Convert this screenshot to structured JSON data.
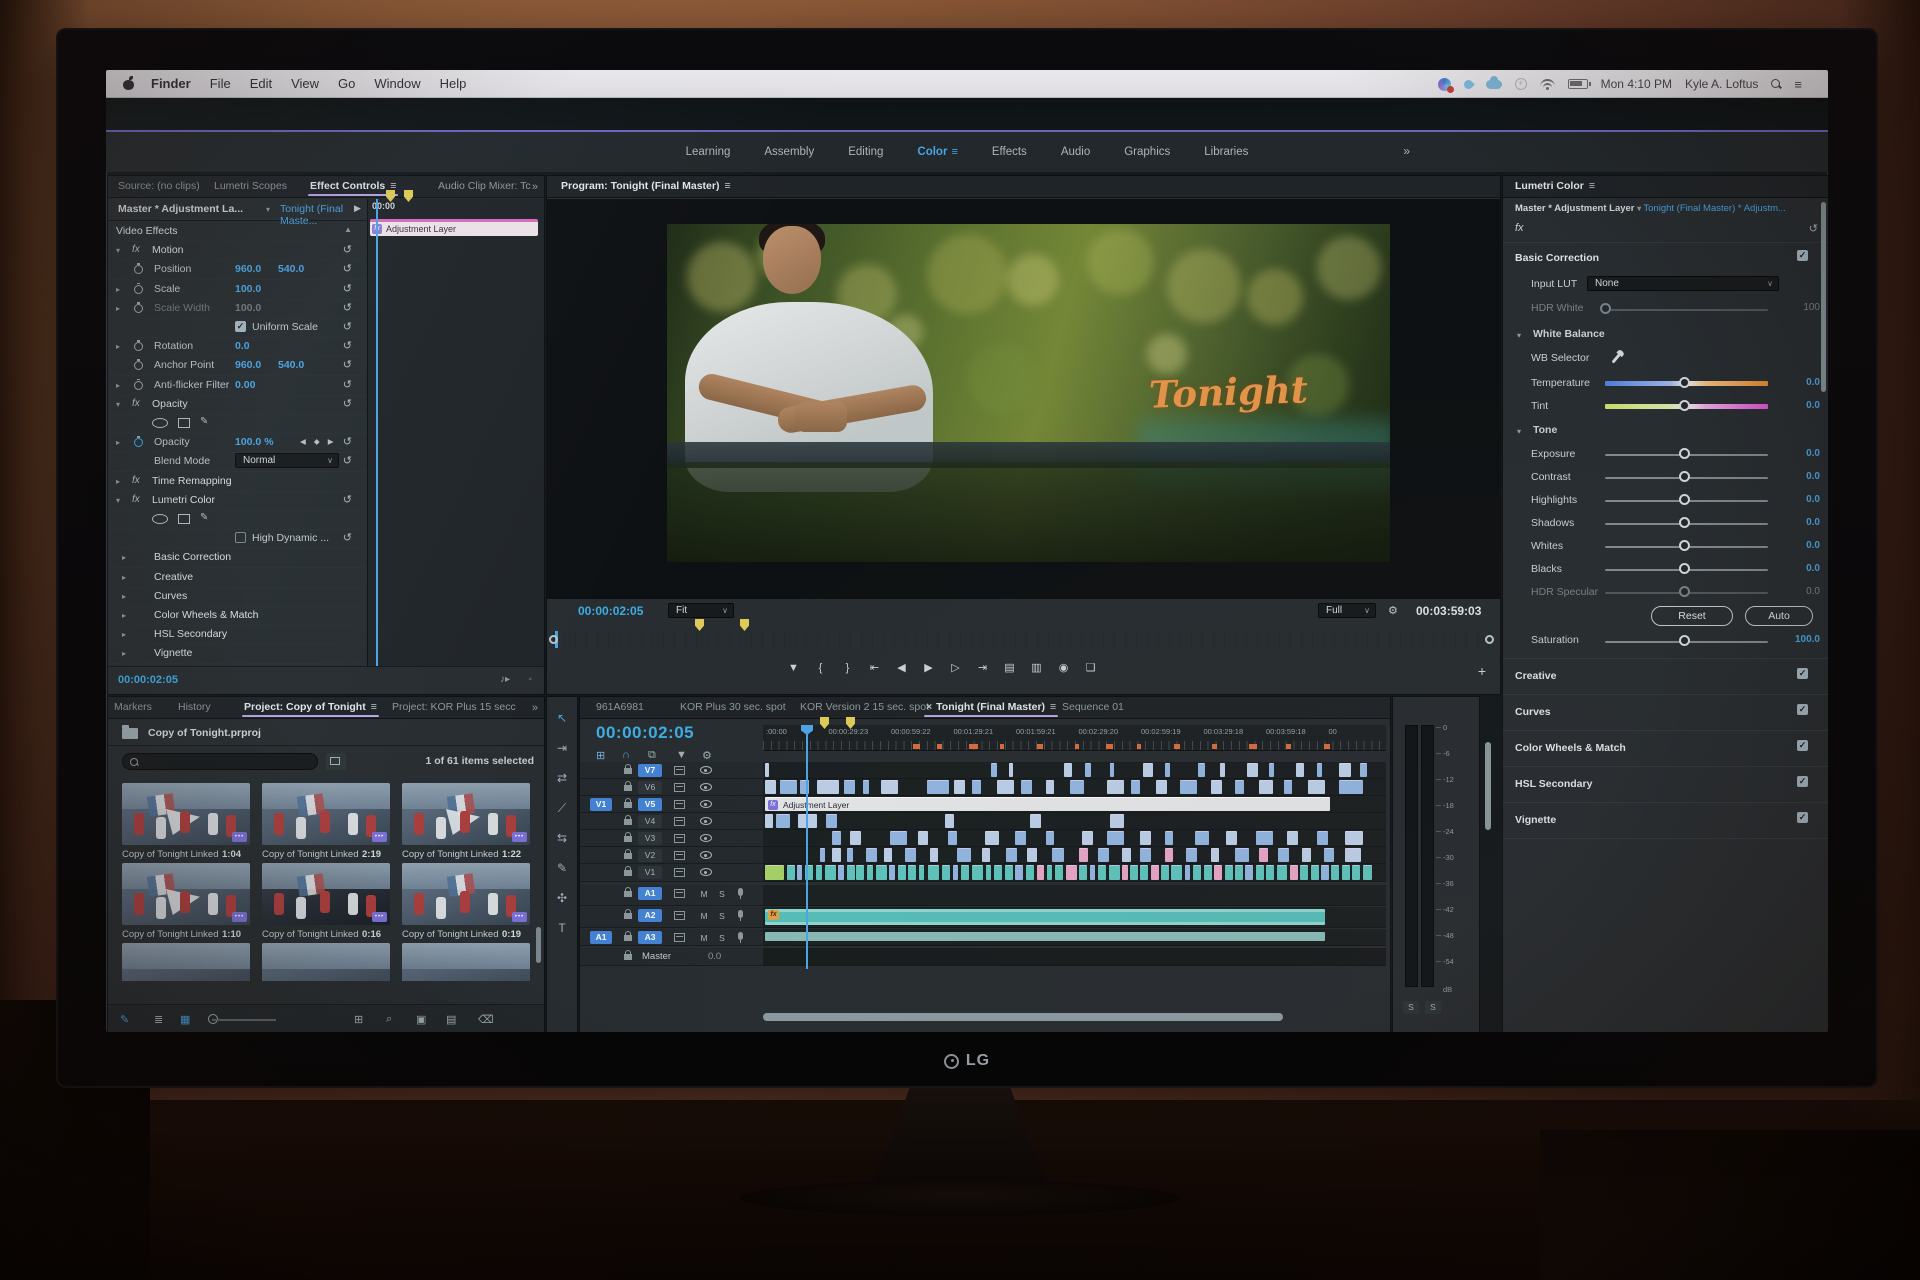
{
  "menubar": {
    "menus": [
      "Finder",
      "File",
      "Edit",
      "View",
      "Go",
      "Window",
      "Help"
    ],
    "status": {
      "time": "Mon 4:10 PM",
      "user": "Kyle A. Loftus"
    }
  },
  "workspace": {
    "tabs": [
      "Learning",
      "Assembly",
      "Editing",
      "Color",
      "Effects",
      "Audio",
      "Graphics",
      "Libraries"
    ],
    "active_index": 3,
    "menu_icon": "≡",
    "overflow": "»"
  },
  "effect_controls": {
    "tabs": [
      "Source: (no clips)",
      "Lumetri Scopes",
      "Effect Controls",
      "Audio Clip Mixer: Tc"
    ],
    "active_index": 2,
    "menu_icon": "≡",
    "overflow": "»",
    "master_label": "Master * Adjustment La...",
    "clip_label": "Tonight (Final Maste...",
    "mini_ruler_label": "00:00",
    "mini_clip_label": "Adjustment Layer",
    "timecode": "00:00:02:05",
    "rows": [
      {
        "type": "section",
        "label": "Video Effects"
      },
      {
        "type": "group",
        "twirl": "v",
        "fx": true,
        "label": "Motion",
        "reset": true
      },
      {
        "type": "param",
        "stopwatch": true,
        "label": "Position",
        "values": [
          "960.0",
          "540.0"
        ],
        "reset": true
      },
      {
        "type": "param",
        "twirl": ">",
        "stopwatch": true,
        "label": "Scale",
        "values": [
          "100.0"
        ],
        "reset": true
      },
      {
        "type": "param",
        "twirl": ">",
        "stopwatch": true,
        "label": "Scale Width",
        "values": [
          "100.0"
        ],
        "dim": true,
        "reset": true
      },
      {
        "type": "checkbox",
        "label": "Uniform Scale",
        "checked": true,
        "reset": true
      },
      {
        "type": "param",
        "twirl": ">",
        "stopwatch": true,
        "label": "Rotation",
        "values": [
          "0.0"
        ],
        "reset": true
      },
      {
        "type": "param",
        "stopwatch": true,
        "label": "Anchor Point",
        "values": [
          "960.0",
          "540.0"
        ],
        "reset": true
      },
      {
        "type": "param",
        "twirl": ">",
        "stopwatch": true,
        "label": "Anti-flicker Filter",
        "values": [
          "0.00"
        ],
        "reset": true
      },
      {
        "type": "group",
        "twirl": "v",
        "fx": true,
        "label": "Opacity",
        "reset": true
      },
      {
        "type": "shapes"
      },
      {
        "type": "param",
        "twirl": ">",
        "stopwatch": true,
        "active": true,
        "label": "Opacity",
        "values": [
          "100.0 %"
        ],
        "keyframes": true,
        "reset": true
      },
      {
        "type": "dropdown",
        "label": "Blend Mode",
        "value": "Normal",
        "reset": true
      },
      {
        "type": "group",
        "twirl": ">",
        "fx": true,
        "label": "Time Remapping"
      },
      {
        "type": "group",
        "twirl": "v",
        "fx": true,
        "label": "Lumetri Color",
        "reset": true
      },
      {
        "type": "shapes"
      },
      {
        "type": "checkbox",
        "label": "High Dynamic ...",
        "checked": false,
        "reset": true
      },
      {
        "type": "section2",
        "label": "Basic Correction"
      },
      {
        "type": "section2",
        "label": "Creative"
      },
      {
        "type": "section2",
        "label": "Curves"
      },
      {
        "type": "section2",
        "label": "Color Wheels & Match"
      },
      {
        "type": "section2",
        "label": "HSL Secondary"
      },
      {
        "type": "section2",
        "label": "Vignette"
      }
    ]
  },
  "program": {
    "tab": "Program: Tonight (Final Master)",
    "menu_icon": "≡",
    "overlay_title": "Tonight",
    "timecode": "00:00:02:05",
    "zoom_level": "Fit",
    "playback_res": "Full",
    "duration": "00:03:59:03",
    "plus_icon": "+"
  },
  "lumetri": {
    "tab": "Lumetri Color",
    "menu_icon": "≡",
    "master_label": "Master * Adjustment Layer",
    "clip_label": "Tonight (Final Master) * Adjustm...",
    "fx_label": "fx",
    "header_label": "Basic Correction",
    "input_lut_label": "Input LUT",
    "input_lut_value": "None",
    "hdr_white_label": "HD​R White",
    "hdr_white_value": "100",
    "white_balance_label": "White Balance",
    "wb_selector_label": "WB Selector",
    "tone_label": "Tone",
    "sliders": [
      {
        "label": "Temperature",
        "value": "0.0",
        "grad": "temp"
      },
      {
        "label": "Tint",
        "value": "0.0",
        "grad": "tint"
      },
      {
        "label": "Exposure",
        "value": "0.0"
      },
      {
        "label": "Contrast",
        "value": "0.0"
      },
      {
        "label": "Highlights",
        "value": "0.0"
      },
      {
        "label": "Shadows",
        "value": "0.0"
      },
      {
        "label": "Whites",
        "value": "0.0"
      },
      {
        "label": "Blacks",
        "value": "0.0"
      },
      {
        "label": "HDR Specular",
        "value": "0.0",
        "dim": true
      }
    ],
    "reset_label": "Reset",
    "auto_label": "Auto",
    "saturation_label": "Saturation",
    "saturation_value": "100.0",
    "sections": [
      "Creative",
      "Curves",
      "Color Wheels & Match",
      "HSL Secondary",
      "Vignette"
    ]
  },
  "project": {
    "tabs": [
      "Markers",
      "History",
      "Project: Copy of Tonight",
      "Project: KOR Plus 15 secc"
    ],
    "active_index": 2,
    "menu_icon": "≡",
    "overflow": "»",
    "bin_name": "Copy of Tonight.prproj",
    "selection_status": "1 of 61 items selected",
    "items": [
      {
        "name": "Copy of Tonight Linked...",
        "duration": "1:04"
      },
      {
        "name": "Copy of Tonight Linked...",
        "duration": "2:19"
      },
      {
        "name": "Copy of Tonight Linked...",
        "duration": "1:22"
      },
      {
        "name": "Copy of Tonight Linked...",
        "duration": "1:10"
      },
      {
        "name": "Copy of Tonight Linked...",
        "duration": "0:16"
      },
      {
        "name": "Copy of Tonight Linked...",
        "duration": "0:19"
      }
    ]
  },
  "timeline": {
    "tabs": [
      "961A6981",
      "KOR Plus 30 sec. spot",
      "KOR Version 2 15 sec. spot",
      "Tonight (Final Master)",
      "Sequence 01"
    ],
    "active_index": 3,
    "close_icon": "×",
    "menu_icon": "≡",
    "timecode": "00:00:02:05",
    "ruler_labels": [
      ":00:00",
      "00:00:29:23",
      "00:00:59:22",
      "00:01:29:21",
      "00:01:59:21",
      "00:02:29:20",
      "00:02:59:19",
      "00:03:29:18",
      "00:03:59:18",
      "00"
    ],
    "ruler_marks": [
      [
        24,
        1.2
      ],
      [
        28,
        0.8
      ],
      [
        33,
        1.5
      ],
      [
        38,
        0.7
      ],
      [
        44,
        1.0
      ],
      [
        50,
        0.8
      ],
      [
        55,
        1.2
      ],
      [
        60,
        0.7
      ],
      [
        66,
        1.0
      ],
      [
        72,
        0.8
      ],
      [
        78,
        1.3
      ],
      [
        84,
        0.7
      ],
      [
        90,
        1.0
      ]
    ],
    "video_tracks": [
      {
        "name": "V7",
        "badge": true
      },
      {
        "name": "V6",
        "badge": false
      },
      {
        "name": "V5",
        "badge": true
      },
      {
        "name": "V4",
        "badge": false
      },
      {
        "name": "V3",
        "badge": false
      },
      {
        "name": "V2",
        "badge": false
      },
      {
        "name": "V1",
        "badge": false
      }
    ],
    "audio_tracks": [
      {
        "name": "A1",
        "badge": true
      },
      {
        "name": "A2",
        "badge": true
      },
      {
        "name": "A3",
        "badge": true
      }
    ],
    "source_patch_video": "V1",
    "source_patch_audio": "A1",
    "mute_label": "M",
    "solo_label": "S",
    "master_label": "Master",
    "master_value": "0.0",
    "adjustment_clip_label": "Adjustment Layer",
    "fx_badge": "fx",
    "palette": [
      "#8fb8e8",
      "#bcd3ee",
      "#efa6cb",
      "#57c9c1",
      "#a4d65e",
      "#e9edef"
    ],
    "clips": {
      "V7": [
        [
          0,
          0.7,
          1
        ],
        [
          37,
          1.1,
          0
        ],
        [
          40,
          0.7,
          1
        ],
        [
          49,
          1.3,
          1
        ],
        [
          52.5,
          0.9,
          0
        ],
        [
          56.5,
          0.7,
          0
        ],
        [
          62,
          1.6,
          1
        ],
        [
          65.5,
          0.9,
          0
        ],
        [
          71,
          1.1,
          0
        ],
        [
          74.5,
          0.8,
          1
        ],
        [
          79,
          1.8,
          1
        ],
        [
          82.5,
          0.9,
          0
        ],
        [
          87,
          1.3,
          1
        ],
        [
          90.5,
          0.8,
          0
        ],
        [
          94,
          2,
          1
        ],
        [
          97.5,
          1.2,
          0
        ]
      ],
      "V6": [
        [
          0,
          1.8,
          1
        ],
        [
          2.4,
          2.8,
          0
        ],
        [
          5.8,
          1.4,
          0
        ],
        [
          8.6,
          3.6,
          1
        ],
        [
          13,
          1.8,
          0
        ],
        [
          16,
          1,
          0
        ],
        [
          19,
          2.8,
          1
        ],
        [
          26.5,
          3.6,
          0
        ],
        [
          31,
          1.8,
          1
        ],
        [
          34,
          1.4,
          0
        ],
        [
          38,
          2.8,
          1
        ],
        [
          42,
          1.8,
          0
        ],
        [
          46,
          1.4,
          1
        ],
        [
          50,
          2.3,
          0
        ],
        [
          56,
          2.8,
          1
        ],
        [
          60,
          1.4,
          0
        ],
        [
          64,
          1.8,
          1
        ],
        [
          68,
          2.8,
          0
        ],
        [
          73,
          1.8,
          1
        ],
        [
          77,
          1.4,
          0
        ],
        [
          81,
          2.3,
          1
        ],
        [
          85,
          1.4,
          0
        ],
        [
          89,
          2.8,
          1
        ],
        [
          94,
          4,
          0
        ]
      ],
      "V4": [
        [
          0,
          1.3,
          1
        ],
        [
          1.8,
          2.3,
          0
        ],
        [
          5.4,
          3.2,
          1
        ],
        [
          10,
          1.8,
          0
        ],
        [
          29.5,
          1.4,
          1
        ],
        [
          43.5,
          1.8,
          1
        ],
        [
          56.5,
          2.3,
          1
        ]
      ],
      "V3": [
        [
          11,
          1.4,
          0
        ],
        [
          14,
          1.8,
          1
        ],
        [
          20.5,
          2.8,
          0
        ],
        [
          25,
          1.8,
          1
        ],
        [
          30,
          1.4,
          0
        ],
        [
          36,
          2.3,
          1
        ],
        [
          41,
          1.8,
          0
        ],
        [
          46,
          1.4,
          0
        ],
        [
          52,
          1.8,
          1
        ],
        [
          56,
          2.8,
          0
        ],
        [
          61.5,
          1.8,
          1
        ],
        [
          65.5,
          1.4,
          0
        ],
        [
          70.5,
          2.3,
          0
        ],
        [
          75.5,
          1.8,
          1
        ],
        [
          80.5,
          2.8,
          0
        ],
        [
          85.5,
          1.8,
          1
        ],
        [
          90.5,
          1.8,
          0
        ],
        [
          95,
          3,
          1
        ]
      ],
      "V2": [
        [
          9,
          0.9,
          0
        ],
        [
          11,
          1.4,
          1
        ],
        [
          13.5,
          0.9,
          0
        ],
        [
          16.5,
          1.8,
          0
        ],
        [
          19.5,
          1.4,
          1
        ],
        [
          23,
          1.8,
          0
        ],
        [
          27,
          1.4,
          1
        ],
        [
          31.5,
          2.3,
          0
        ],
        [
          35.5,
          1.4,
          1
        ],
        [
          39.5,
          1.8,
          0
        ],
        [
          43,
          1.6,
          1
        ],
        [
          47,
          2,
          0
        ],
        [
          51.5,
          1.4,
          2
        ],
        [
          54.5,
          1.8,
          0
        ],
        [
          58.5,
          1.4,
          1
        ],
        [
          61.5,
          1.8,
          0
        ],
        [
          65.5,
          1.4,
          2
        ],
        [
          69,
          1.8,
          0
        ],
        [
          73,
          1.4,
          1
        ],
        [
          77,
          2.3,
          0
        ],
        [
          81,
          1.4,
          2
        ],
        [
          84,
          1.8,
          0
        ],
        [
          88,
          1.4,
          1
        ],
        [
          91.5,
          1.8,
          0
        ],
        [
          95,
          2.6,
          1
        ]
      ],
      "V1": [
        [
          0,
          3.2,
          4
        ],
        [
          3.6,
          1.3,
          3
        ],
        [
          5.2,
          0.9,
          0
        ],
        [
          6.6,
          1.3,
          3
        ],
        [
          8.4,
          0.9,
          3
        ],
        [
          9.8,
          1.8,
          3
        ],
        [
          12,
          0.9,
          0
        ],
        [
          13.4,
          1.3,
          3
        ],
        [
          15,
          1.3,
          3
        ],
        [
          16.8,
          0.9,
          3
        ],
        [
          18.2,
          1.8,
          3
        ],
        [
          20.4,
          0.9,
          0
        ],
        [
          21.8,
          1.3,
          3
        ],
        [
          23.5,
          1.3,
          3
        ],
        [
          25.2,
          0.9,
          3
        ],
        [
          26.8,
          1.8,
          3
        ],
        [
          29,
          1.3,
          3
        ],
        [
          30.8,
          0.9,
          0
        ],
        [
          32.2,
          1.3,
          3
        ],
        [
          34,
          1.8,
          3
        ],
        [
          36.2,
          0.9,
          3
        ],
        [
          37.6,
          1.3,
          3
        ],
        [
          39.3,
          1.3,
          3
        ],
        [
          41,
          1.3,
          0
        ],
        [
          42.8,
          1.3,
          3
        ],
        [
          44.5,
          1.3,
          2
        ],
        [
          46.2,
          0.9,
          3
        ],
        [
          47.6,
          1.3,
          3
        ],
        [
          49.3,
          1.8,
          2
        ],
        [
          51.5,
          1.3,
          3
        ],
        [
          53.2,
          0.9,
          0
        ],
        [
          54.6,
          1.3,
          3
        ],
        [
          56.3,
          1.8,
          3
        ],
        [
          58.5,
          0.9,
          2
        ],
        [
          59.8,
          1.3,
          3
        ],
        [
          61.5,
          1.3,
          3
        ],
        [
          63.2,
          1.3,
          2
        ],
        [
          64.9,
          1.3,
          3
        ],
        [
          66.6,
          1.8,
          3
        ],
        [
          68.8,
          0.9,
          0
        ],
        [
          70.2,
          1.3,
          3
        ],
        [
          71.9,
          1.3,
          3
        ],
        [
          73.6,
          1.3,
          2
        ],
        [
          75.3,
          1.3,
          3
        ],
        [
          77,
          1.3,
          3
        ],
        [
          78.7,
          1.3,
          0
        ],
        [
          80.4,
          1.3,
          3
        ],
        [
          82.1,
          1.3,
          3
        ],
        [
          83.8,
          1.8,
          3
        ],
        [
          86,
          1.3,
          2
        ],
        [
          87.7,
          1.3,
          3
        ],
        [
          89.4,
          1.3,
          3
        ],
        [
          91.1,
          1.3,
          0
        ],
        [
          92.8,
          1.3,
          3
        ],
        [
          94.5,
          1.3,
          3
        ],
        [
          96.2,
          1.3,
          3
        ],
        [
          97.9,
          1.6,
          3
        ]
      ]
    }
  },
  "audio_meter": {
    "ticks": [
      "0",
      "-6",
      "-12",
      "-18",
      "-24",
      "-30",
      "-36",
      "-42",
      "-48",
      "-54"
    ],
    "unit": "dB",
    "solo_label": "S"
  },
  "monitor_brand": "LG"
}
